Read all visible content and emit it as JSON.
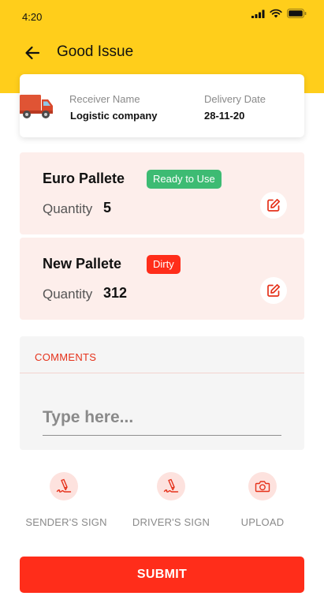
{
  "status_bar": {
    "time": "4:20"
  },
  "header": {
    "title": "Good Issue"
  },
  "info_card": {
    "receiver_label": "Receiver Name",
    "receiver_value": "Logistic company",
    "delivery_label": "Delivery Date",
    "delivery_value": "28-11-20"
  },
  "pallets": [
    {
      "name": "Euro Pallete",
      "status": "Ready to Use",
      "status_color": "#3DBB73",
      "quantity_label": "Quantity",
      "quantity": "5"
    },
    {
      "name": "New Pallete",
      "status": "Dirty",
      "status_color": "#FF2D1A",
      "quantity_label": "Quantity",
      "quantity": "312"
    }
  ],
  "comments": {
    "label": "COMMENTS",
    "placeholder": "Type here..."
  },
  "actions": [
    {
      "label": "SENDER'S SIGN",
      "icon": "signature-icon"
    },
    {
      "label": "DRIVER'S SIGN",
      "icon": "signature-icon"
    },
    {
      "label": "UPLOAD",
      "icon": "camera-icon"
    }
  ],
  "submit": {
    "label": "SUBMIT"
  },
  "colors": {
    "header": "#FFCE1B",
    "accent": "#FF2D1A",
    "card_tint": "#FDEEEB"
  }
}
